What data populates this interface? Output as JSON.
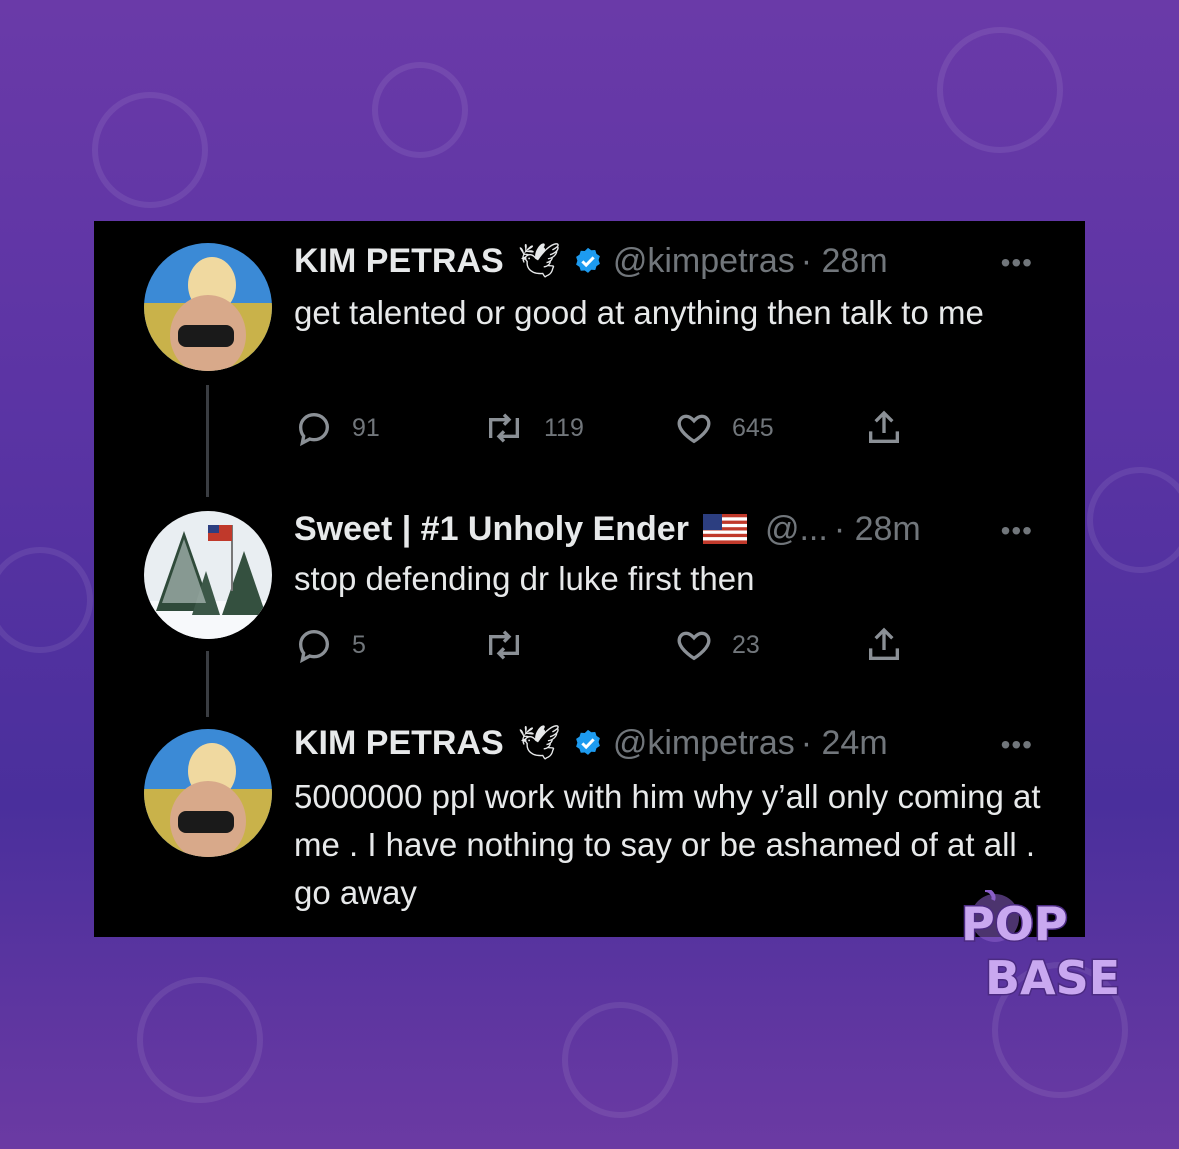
{
  "watermark": {
    "line1": "POP",
    "line2": "BASE"
  },
  "tweets": [
    {
      "name": "KIM PETRAS",
      "handle": "@kimpetras",
      "time": "· 28m",
      "text": "get talented or good at anything then talk to me",
      "replies": "91",
      "retweets": "119",
      "likes": "645",
      "more": "•••"
    },
    {
      "name": "Sweet | #1 Unholy Ender",
      "handle": "@...",
      "time": "· 28m",
      "text": "stop defending dr luke first then",
      "replies": "5",
      "retweets": "",
      "likes": "23",
      "more": "•••"
    },
    {
      "name": "KIM PETRAS",
      "handle": "@kimpetras",
      "time": "· 24m",
      "text": "5000000 ppl work with him why y’all only coming at me . I have nothing to say or be ashamed of at all . go away",
      "more": "•••"
    }
  ]
}
